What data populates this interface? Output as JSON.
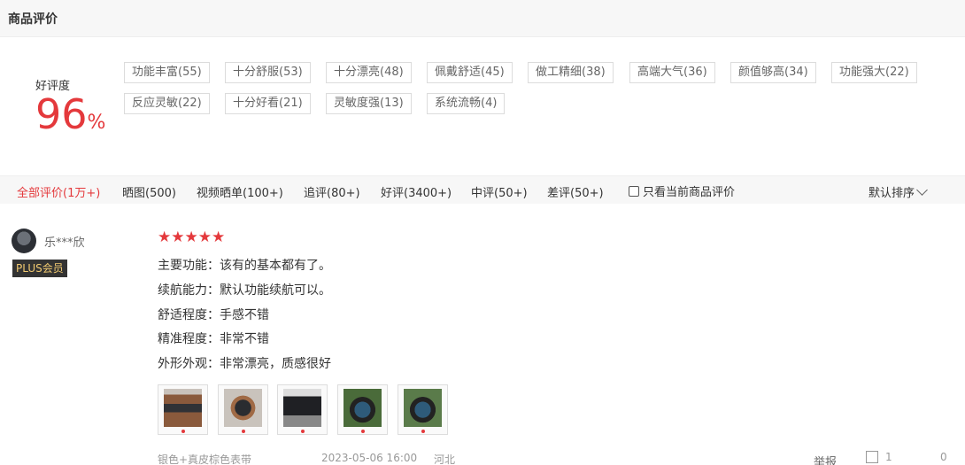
{
  "header": {
    "title": "商品评价"
  },
  "rating": {
    "label": "好评度",
    "value": "96",
    "unit": "%"
  },
  "tags": [
    "功能丰富(55)",
    "十分舒服(53)",
    "十分漂亮(48)",
    "佩戴舒适(45)",
    "做工精细(38)",
    "高端大气(36)",
    "颜值够高(34)",
    "功能强大(22)",
    "反应灵敏(22)",
    "十分好看(21)",
    "灵敏度强(13)",
    "系统流畅(4)"
  ],
  "filters": [
    "全部评价(1万+)",
    "晒图(500)",
    "视频晒单(100+)",
    "追评(80+)",
    "好评(3400+)",
    "中评(50+)",
    "差评(50+)"
  ],
  "only_current_label": "只看当前商品评价",
  "sort_label": "默认排序",
  "review": {
    "user_name": "乐***欣",
    "member_badge": "PLUS会员",
    "stars": 5,
    "star_glyph": "★",
    "lines": [
      "主要功能：该有的基本都有了。",
      "续航能力：默认功能续航可以。",
      "舒适程度：手感不错",
      "精准程度：非常不错",
      "外形外观：非常漂亮，质感很好"
    ],
    "image_count": 5,
    "variant": "银色+真皮棕色表带",
    "datetime": "2023-05-06 16:00",
    "location": "河北",
    "report_label": "举报",
    "like_count": "1",
    "reply_count": "0"
  },
  "colors": {
    "accent": "#e4393c",
    "bar_bg": "#f7f7f7",
    "badge_bg": "#333333",
    "badge_text": "#f0c970"
  }
}
